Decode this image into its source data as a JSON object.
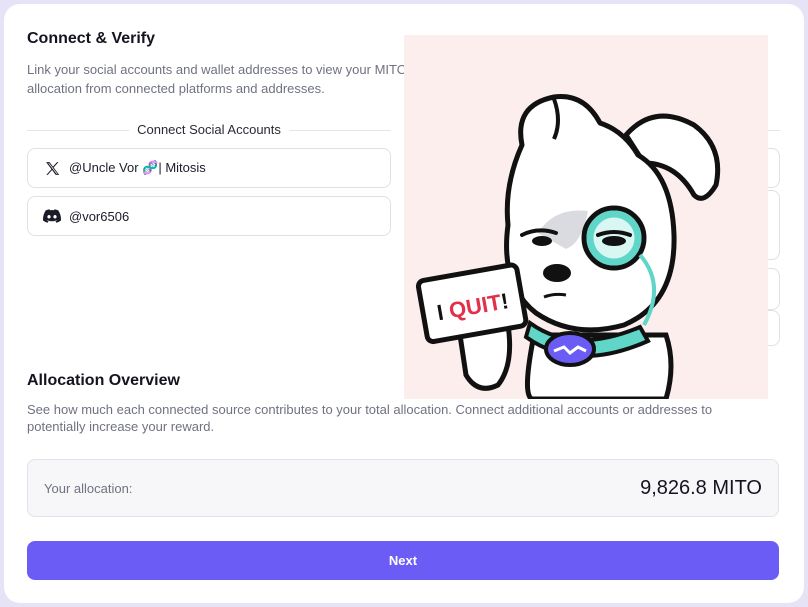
{
  "connect": {
    "title": "Connect & Verify",
    "subtitle": "Link your social accounts and wallet addresses to view your MITO allocation from connected platforms and addresses.",
    "social_header": "Connect Social Accounts",
    "accounts": [
      {
        "platform_icon": "x-logo-icon",
        "handle": "@Uncle Vor 🧬| Mitosis"
      },
      {
        "platform_icon": "discord-logo-icon",
        "handle": "@vor6506"
      }
    ]
  },
  "allocation": {
    "title": "Allocation Overview",
    "subtitle": "See how much each connected source contributes to your total allocation. Connect additional accounts or addresses to potentially increase your reward.",
    "label": "Your allocation:",
    "value": "9,826.8 MITO"
  },
  "sticker": {
    "sign_text_a": "I ",
    "sign_text_b": "QUIT",
    "sign_text_c": "!"
  },
  "actions": {
    "next_label": "Next"
  },
  "colors": {
    "accent": "#6c5cf6",
    "sticker_bg": "#fdeeee",
    "monocle": "#5fd6c8"
  }
}
